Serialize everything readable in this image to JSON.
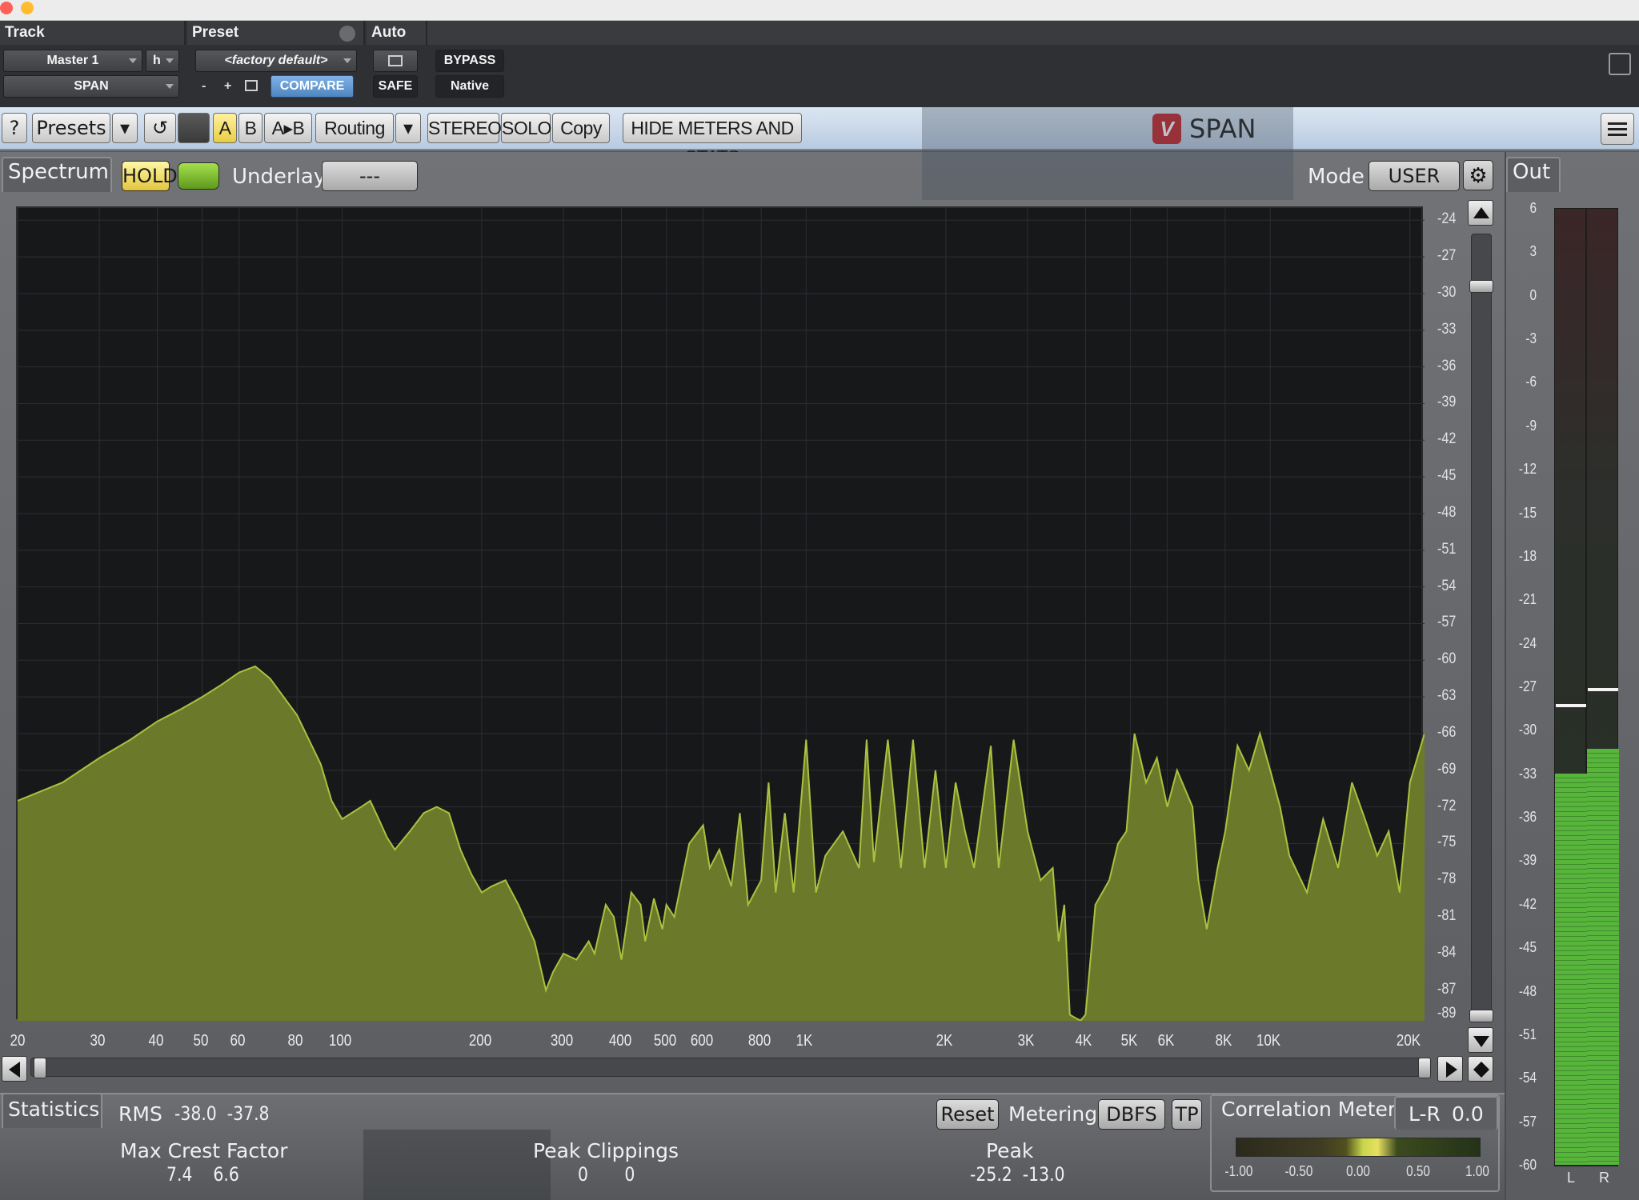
{
  "pt_header": {
    "track_heading": "Track",
    "preset_heading": "Preset",
    "auto_heading": "Auto",
    "track_name": "Master 1",
    "track_insert": "h",
    "plugin_name": "SPAN",
    "preset_name": "<factory default>",
    "minus": "-",
    "plus": "+",
    "compare": "COMPARE",
    "bypass": "BYPASS",
    "safe": "SAFE",
    "native": "Native"
  },
  "toolbar": {
    "help": "?",
    "presets": "Presets",
    "dropdown": "▾",
    "undo": "↺",
    "a": "A",
    "b": "B",
    "a_to_b": "A▸B",
    "routing": "Routing",
    "stereo": "STEREO",
    "solo": "SOLO",
    "copy": "Copy",
    "hide_meters": "HIDE METERS AND STATS",
    "logo_text": "V",
    "plugin_title": "SPAN"
  },
  "spectrum": {
    "tab_label": "Spectrum",
    "hold": "HOLD",
    "underlay_label": "Underlay",
    "underlay_value": "---",
    "mode_label": "Mode",
    "mode_value": "USER",
    "db_scale": [
      "-24",
      "-27",
      "-30",
      "-33",
      "-36",
      "-39",
      "-42",
      "-45",
      "-48",
      "-51",
      "-54",
      "-57",
      "-60",
      "-63",
      "-66",
      "-69",
      "-72",
      "-75",
      "-78",
      "-81",
      "-84",
      "-87",
      "-89"
    ],
    "freq_scale": [
      {
        "label": "20",
        "hz": 20
      },
      {
        "label": "30",
        "hz": 30
      },
      {
        "label": "40",
        "hz": 40
      },
      {
        "label": "50",
        "hz": 50
      },
      {
        "label": "60",
        "hz": 60
      },
      {
        "label": "80",
        "hz": 80
      },
      {
        "label": "100",
        "hz": 100
      },
      {
        "label": "200",
        "hz": 200
      },
      {
        "label": "300",
        "hz": 300
      },
      {
        "label": "400",
        "hz": 400
      },
      {
        "label": "500",
        "hz": 500
      },
      {
        "label": "600",
        "hz": 600
      },
      {
        "label": "800",
        "hz": 800
      },
      {
        "label": "1K",
        "hz": 1000
      },
      {
        "label": "2K",
        "hz": 2000
      },
      {
        "label": "3K",
        "hz": 3000
      },
      {
        "label": "4K",
        "hz": 4000
      },
      {
        "label": "5K",
        "hz": 5000
      },
      {
        "label": "6K",
        "hz": 6000
      },
      {
        "label": "8K",
        "hz": 8000
      },
      {
        "label": "10K",
        "hz": 10000
      },
      {
        "label": "20K",
        "hz": 20000
      }
    ],
    "fill_color": "#6b7a2a",
    "line_color": "#a9c23f",
    "curve": [
      [
        20,
        -71.5
      ],
      [
        25,
        -70
      ],
      [
        30,
        -68
      ],
      [
        35,
        -66.5
      ],
      [
        40,
        -65
      ],
      [
        45,
        -64
      ],
      [
        50,
        -63
      ],
      [
        55,
        -62
      ],
      [
        60,
        -61
      ],
      [
        65,
        -60.5
      ],
      [
        70,
        -61.5
      ],
      [
        80,
        -64.5
      ],
      [
        90,
        -68.5
      ],
      [
        95,
        -71.5
      ],
      [
        100,
        -73
      ],
      [
        110,
        -72
      ],
      [
        115,
        -71.5
      ],
      [
        120,
        -73
      ],
      [
        125,
        -74.5
      ],
      [
        130,
        -75.5
      ],
      [
        140,
        -74
      ],
      [
        150,
        -72.5
      ],
      [
        160,
        -72
      ],
      [
        170,
        -72.5
      ],
      [
        180,
        -75.5
      ],
      [
        190,
        -77.5
      ],
      [
        200,
        -79
      ],
      [
        210,
        -78.5
      ],
      [
        225,
        -78
      ],
      [
        240,
        -80
      ],
      [
        260,
        -83
      ],
      [
        275,
        -87
      ],
      [
        285,
        -85.5
      ],
      [
        300,
        -84
      ],
      [
        320,
        -84.5
      ],
      [
        340,
        -83
      ],
      [
        350,
        -84
      ],
      [
        370,
        -80
      ],
      [
        385,
        -81
      ],
      [
        400,
        -84.5
      ],
      [
        420,
        -79
      ],
      [
        440,
        -80
      ],
      [
        450,
        -83
      ],
      [
        470,
        -79.5
      ],
      [
        490,
        -82
      ],
      [
        500,
        -80
      ],
      [
        520,
        -81
      ],
      [
        560,
        -75
      ],
      [
        600,
        -73.5
      ],
      [
        620,
        -77
      ],
      [
        650,
        -75.5
      ],
      [
        690,
        -78.5
      ],
      [
        720,
        -72.5
      ],
      [
        750,
        -80
      ],
      [
        800,
        -78
      ],
      [
        830,
        -70
      ],
      [
        860,
        -79
      ],
      [
        900,
        -72.5
      ],
      [
        940,
        -79
      ],
      [
        1000,
        -66.5
      ],
      [
        1050,
        -79
      ],
      [
        1100,
        -76
      ],
      [
        1200,
        -74
      ],
      [
        1300,
        -77
      ],
      [
        1350,
        -66.5
      ],
      [
        1400,
        -76.5
      ],
      [
        1500,
        -66.5
      ],
      [
        1600,
        -77
      ],
      [
        1700,
        -66.5
      ],
      [
        1800,
        -77
      ],
      [
        1900,
        -69
      ],
      [
        2000,
        -77
      ],
      [
        2100,
        -70
      ],
      [
        2200,
        -74
      ],
      [
        2300,
        -77
      ],
      [
        2500,
        -67
      ],
      [
        2600,
        -77
      ],
      [
        2800,
        -66.5
      ],
      [
        3000,
        -74
      ],
      [
        3200,
        -78
      ],
      [
        3400,
        -77
      ],
      [
        3500,
        -83
      ],
      [
        3600,
        -80
      ],
      [
        3700,
        -89
      ],
      [
        3900,
        -90
      ],
      [
        4000,
        -89
      ],
      [
        4200,
        -80
      ],
      [
        4500,
        -78
      ],
      [
        4700,
        -75
      ],
      [
        4900,
        -74
      ],
      [
        5100,
        -66
      ],
      [
        5400,
        -70
      ],
      [
        5700,
        -68
      ],
      [
        6000,
        -72
      ],
      [
        6300,
        -69
      ],
      [
        6800,
        -72
      ],
      [
        7000,
        -78
      ],
      [
        7300,
        -82
      ],
      [
        7700,
        -77
      ],
      [
        8000,
        -74
      ],
      [
        8500,
        -67
      ],
      [
        9000,
        -69
      ],
      [
        9500,
        -66
      ],
      [
        10000,
        -69
      ],
      [
        10500,
        -72
      ],
      [
        11000,
        -76
      ],
      [
        12000,
        -79
      ],
      [
        13000,
        -73
      ],
      [
        14000,
        -77
      ],
      [
        15000,
        -70
      ],
      [
        16000,
        -73
      ],
      [
        17000,
        -76
      ],
      [
        18000,
        -74
      ],
      [
        19000,
        -79
      ],
      [
        20000,
        -70
      ],
      [
        21500,
        -66
      ]
    ]
  },
  "statistics": {
    "tab_label": "Statistics",
    "rms_label": "RMS",
    "rms_values": "-38.0  -37.8",
    "reset": "Reset",
    "metering_label": "Metering",
    "metering_mode": "DBFS",
    "tp": "TP",
    "max_crest_label": "Max Crest Factor",
    "max_crest_values": "7.4    6.6",
    "peak_clip_label": "Peak Clippings",
    "peak_clip_values": "0       0",
    "peak_label": "Peak",
    "peak_values": "-25.2  -13.0"
  },
  "correlation": {
    "title": "Correlation Meter",
    "mode": "L-R",
    "value": "0.0",
    "scale": [
      "-1.00",
      "-0.50",
      "0.00",
      "0.50",
      "1.00"
    ]
  },
  "output_meter": {
    "title": "Out",
    "scale": [
      "6",
      "3",
      "0",
      "-3",
      "-6",
      "-9",
      "-12",
      "-15",
      "-18",
      "-21",
      "-24",
      "-27",
      "-30",
      "-33",
      "-36",
      "-39",
      "-42",
      "-45",
      "-48",
      "-51",
      "-54",
      "-57",
      "-60"
    ],
    "left_label": "L",
    "right_label": "R",
    "left_level_db": -33,
    "right_level_db": -31.3,
    "left_hold_db": -28.2,
    "right_hold_db": -27.1
  }
}
